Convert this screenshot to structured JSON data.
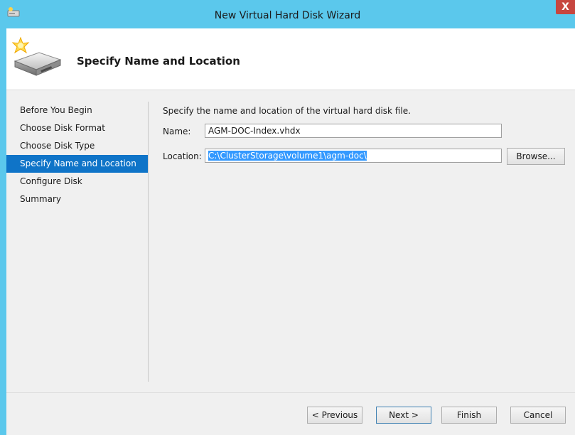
{
  "window": {
    "title": "New Virtual Hard Disk Wizard",
    "close_label": "X"
  },
  "header": {
    "title": "Specify Name and Location"
  },
  "sidebar": {
    "items": [
      {
        "label": "Before You Begin"
      },
      {
        "label": "Choose Disk Format"
      },
      {
        "label": "Choose Disk Type"
      },
      {
        "label": "Specify Name and Location",
        "active": true
      },
      {
        "label": "Configure Disk"
      },
      {
        "label": "Summary"
      }
    ]
  },
  "content": {
    "instructions": "Specify the name and location of the virtual hard disk file.",
    "name_label": "Name:",
    "name_value": "AGM-DOC-Index.vhdx",
    "location_label": "Location:",
    "location_value": "C:\\ClusterStorage\\volume1\\agm-doc\\",
    "browse_label": "Browse..."
  },
  "footer": {
    "previous_label": "< Previous",
    "next_label": "Next >",
    "finish_label": "Finish",
    "cancel_label": "Cancel"
  },
  "colors": {
    "titlebar": "#5bc8ec",
    "selection": "#0f74c8",
    "close": "#c7463f"
  }
}
